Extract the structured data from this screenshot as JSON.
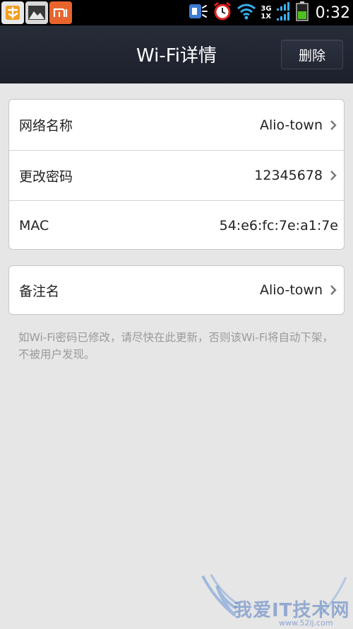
{
  "status_bar": {
    "time": "0:32",
    "network_top": "3G",
    "network_bottom": "1X",
    "icons": [
      "app-notification-icon",
      "gallery-icon",
      "mi-icon",
      "video-call-icon",
      "alarm-clock-icon",
      "wifi-icon",
      "signal-icon",
      "battery-icon"
    ]
  },
  "header": {
    "title": "Wi-Fi详情",
    "delete_label": "删除"
  },
  "details": [
    {
      "label": "网络名称",
      "value": "Alio-town"
    },
    {
      "label": "更改密码",
      "value": "12345678"
    },
    {
      "label": "MAC",
      "value": "54:e6:fc:7e:a1:7e"
    }
  ],
  "remark": {
    "label": "备注名",
    "value": "Alio-town"
  },
  "hint": "如Wi-Fi密码已修改，请尽快在此更新，否则该Wi-Fi将自动下架，不被用户发现。",
  "watermark": {
    "text": "我爱IT技术网",
    "url": "www.52ij.com"
  },
  "colors": {
    "title_bar": "#1f2431",
    "background": "#e6e6e6",
    "mi_orange": "#e8642d"
  }
}
